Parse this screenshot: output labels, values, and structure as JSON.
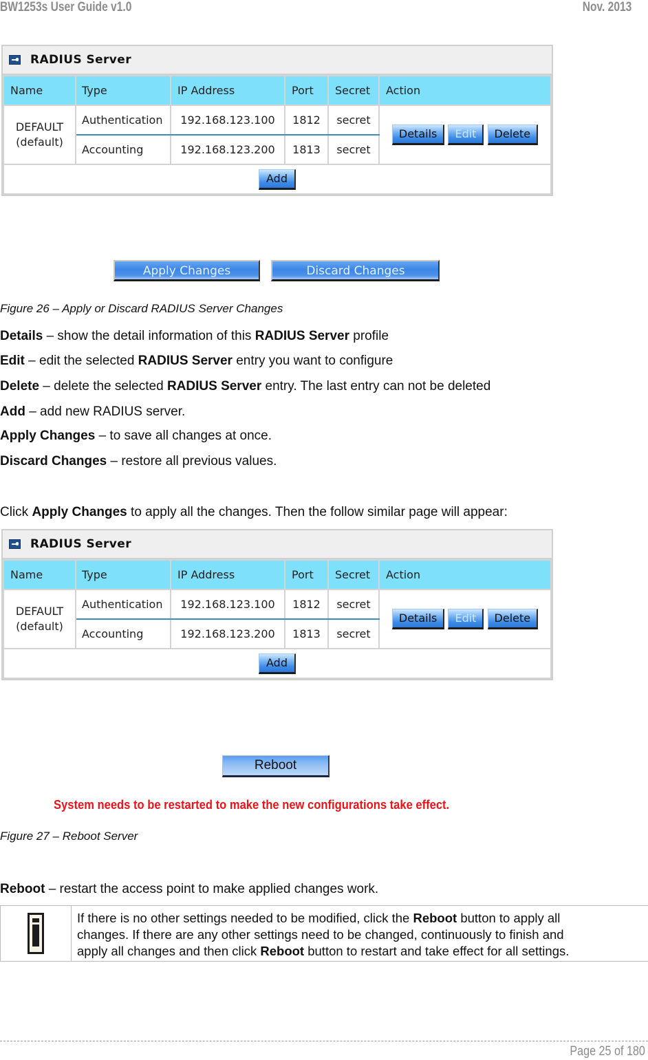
{
  "header": {
    "doc_title": "BW1253s User Guide v1.0",
    "date": "Nov.  2013"
  },
  "radius_panel": {
    "title": "RADIUS Server",
    "icon": "minus-toggle-icon",
    "columns": [
      "Name",
      "Type",
      "IP Address",
      "Port",
      "Secret",
      "Action"
    ],
    "entry": {
      "name": "DEFAULT",
      "name_sub": "(default)",
      "rows": [
        {
          "type": "Authentication",
          "ip": "192.168.123.100",
          "port": "1812",
          "secret": "secret"
        },
        {
          "type": "Accounting",
          "ip": "192.168.123.200",
          "port": "1813",
          "secret": "secret"
        }
      ]
    },
    "actions": {
      "details": "Details",
      "edit": "Edit",
      "delete": "Delete"
    },
    "add_label": "Add"
  },
  "figure26": {
    "apply_label": "Apply Changes",
    "discard_label": "Discard Changes",
    "caption": "Figure 26 – Apply or Discard RADIUS Server Changes"
  },
  "descriptions": [
    {
      "term": "Details",
      "pre": " – show the detail information of this ",
      "bold2": "RADIUS Server",
      "post": " profile"
    },
    {
      "term": "Edit",
      "pre": " – edit the selected ",
      "bold2": "RADIUS Server",
      "post": " entry you want to configure"
    },
    {
      "term": "Delete",
      "pre": " – delete the selected ",
      "bold2": "RADIUS Server",
      "post": " entry. The last entry can not be deleted"
    },
    {
      "term": "Add",
      "pre": " – add new RADIUS server.",
      "bold2": "",
      "post": ""
    },
    {
      "term": "Apply Changes",
      "pre": " – to save all changes at once.",
      "bold2": "",
      "post": ""
    },
    {
      "term": "Discard Changes",
      "pre": " – restore all previous values.",
      "bold2": "",
      "post": ""
    }
  ],
  "click_para": {
    "pre": "Click ",
    "bold": "Apply Changes",
    "post": " to apply all the changes. Then the follow similar page will appear:"
  },
  "figure27": {
    "reboot_label": "Reboot",
    "restart_message": "System needs to be restarted to make the new configurations take effect.",
    "message_color": "#e8141b",
    "caption": "Figure 27 – Reboot Server"
  },
  "reboot_desc": {
    "term": "Reboot",
    "text": " – restart the access point to make applied changes work."
  },
  "note": {
    "icon": "info-icon",
    "l1_pre": "If there is no other settings needed to be modified, click the ",
    "l1_bold": "Reboot",
    "l1_post": " button to apply all",
    "l2": "changes. If there are any other settings need to be changed, continuously to finish and",
    "l3_pre": "apply all changes and then click ",
    "l3_bold": "Reboot",
    "l3_post": " button to restart and take effect  for all settings."
  },
  "footer": {
    "page": "Page 25 of 180"
  }
}
